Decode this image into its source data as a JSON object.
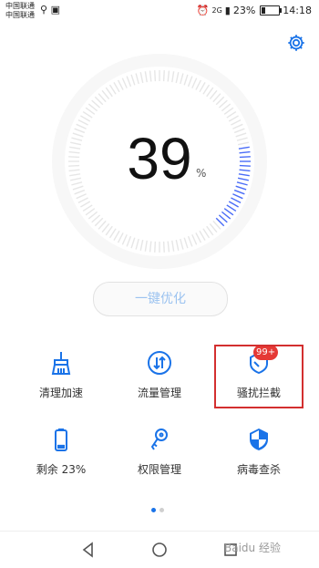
{
  "status_bar": {
    "carrier_1": "中国联通",
    "carrier_2": "中国联通",
    "left_icons": [
      "usb-icon",
      "sim-icon"
    ],
    "alarm": "alarm-icon",
    "network_tag": "2G",
    "battery_percent": "23%",
    "battery_level": 0.23,
    "time": "14:18"
  },
  "settings_icon": "gear-icon",
  "gauge": {
    "value": "39",
    "unit": "%",
    "fraction": 0.39,
    "accent_color": "#4a6cf7",
    "track_color": "#e6e6e6"
  },
  "optimize_button": {
    "label": "一键优化"
  },
  "tiles": [
    {
      "label": "清理加速",
      "icon": "broom-icon"
    },
    {
      "label": "流量管理",
      "icon": "data-traffic-icon"
    },
    {
      "label": "骚扰拦截",
      "icon": "block-shield-icon",
      "badge": "99+"
    },
    {
      "label": "剩余 23%",
      "icon": "battery-icon"
    },
    {
      "label": "权限管理",
      "icon": "key-icon"
    },
    {
      "label": "病毒查杀",
      "icon": "virus-shield-icon"
    }
  ],
  "pager": {
    "pages": 2,
    "current": 1
  },
  "nav": [
    "back-icon",
    "home-icon",
    "recents-icon"
  ],
  "watermark": "Baidu 经验",
  "colors": {
    "accent": "#1a73e8",
    "highlight": "#d32f2f",
    "badge": "#e53935"
  }
}
